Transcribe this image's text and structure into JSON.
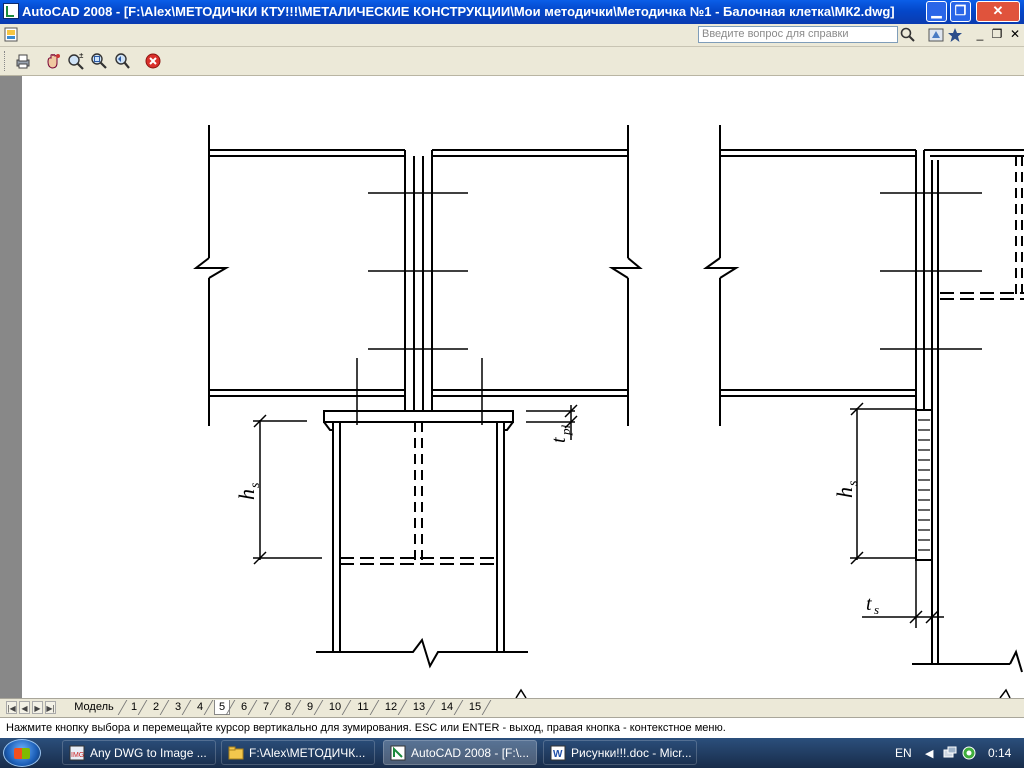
{
  "window": {
    "title": "AutoCAD 2008 - [F:\\Alex\\МЕТОДИЧКИ КТУ!!!\\МЕТАЛИЧЕСКИЕ КОНСТРУКЦИИ\\Мои методички\\Методичка №1 - Балочная клетка\\МК2.dwg]",
    "minimize_glyph": "▁",
    "restore_glyph": "❐",
    "close_glyph": "✕"
  },
  "menubar": {
    "help_placeholder": "Введите вопрос для справки",
    "mdi_minimize": "_",
    "mdi_restore": "❐",
    "mdi_close": "✕"
  },
  "toolbar": {
    "icons": [
      "print-icon",
      "pan-icon",
      "zoom-realtime-icon",
      "zoom-window-icon",
      "zoom-previous-icon",
      "close-view-icon"
    ]
  },
  "drawing": {
    "labels": {
      "hs_left": "h",
      "hs_left_sub": "s",
      "tpl": "t",
      "tpl_sub": "pl",
      "hs_right": "h",
      "hs_right_sub": "s",
      "ts": "t",
      "ts_sub": "s"
    }
  },
  "layout_tabs": {
    "model": "Модель",
    "tabs": [
      "1",
      "2",
      "3",
      "4",
      "5",
      "6",
      "7",
      "8",
      "9",
      "10",
      "11",
      "12",
      "13",
      "14",
      "15"
    ],
    "active": "5"
  },
  "command_line": {
    "text": "Нажмите кнопку выбора и перемещайте курсор вертикально для зумирования. ESC или ENTER - выход, правая кнопка - контекстное меню."
  },
  "taskbar": {
    "tasks": [
      {
        "label": "Any DWG to Image ...",
        "active": false
      },
      {
        "label": "F:\\Alex\\МЕТОДИЧК...",
        "active": false
      },
      {
        "label": "AutoCAD 2008 - [F:\\...",
        "active": true
      },
      {
        "label": "Рисунки!!!.doc - Micr...",
        "active": false
      }
    ],
    "language": "EN",
    "clock": "0:14"
  },
  "colors": {
    "title_bar": "#0a4fd6",
    "drawing_bg": "#ffffff",
    "line": "#000000",
    "taskbar": "#1f3a5f"
  }
}
